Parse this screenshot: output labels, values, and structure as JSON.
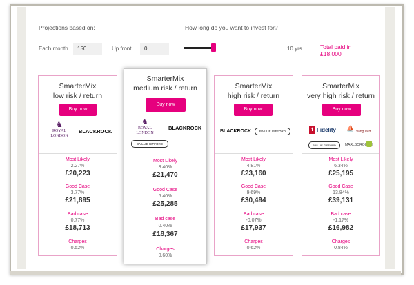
{
  "header": {
    "projections_label": "Projections based on:",
    "duration_question": "How long do you want to invest for?",
    "each_month_label": "Each month",
    "each_month_value": "150",
    "up_front_label": "Up front",
    "up_front_value": "0",
    "years_label": "10 yrs",
    "total_line1": "Total paid in",
    "total_line2": "£18,000",
    "slider_fraction": 1.0
  },
  "colors": {
    "accent": "#e6007e",
    "border": "#e9a3c8"
  },
  "cards": [
    {
      "title1": "SmarterMix",
      "title2": "low risk / return",
      "buy": "Buy now",
      "logos": [
        "ROYAL LONDON",
        "BLACKROCK"
      ],
      "most_likely_label": "Most Likely",
      "most_likely_pct": "2.27%",
      "most_likely_amt": "£20,223",
      "good_label": "Good Case",
      "good_pct": "3.77%",
      "good_amt": "£21,895",
      "bad_label": "Bad case",
      "bad_pct": "0.77%",
      "bad_amt": "£18,713",
      "charges_label": "Charges",
      "charges_pct": "0.52%"
    },
    {
      "title1": "SmarterMix",
      "title2": "medium risk / return",
      "buy": "Buy now",
      "logos": [
        "ROYAL LONDON",
        "BLACKROCK",
        "BAILLIE GIFFORD"
      ],
      "most_likely_label": "Most Likely",
      "most_likely_pct": "3.40%",
      "most_likely_amt": "£21,470",
      "good_label": "Good Case",
      "good_pct": "6.40%",
      "good_amt": "£25,285",
      "bad_label": "Bad case",
      "bad_pct": "0.40%",
      "bad_amt": "£18,367",
      "charges_label": "Charges",
      "charges_pct": "0.60%"
    },
    {
      "title1": "SmarterMix",
      "title2": "high risk / return",
      "buy": "Buy now",
      "logos": [
        "BLACKROCK",
        "BAILLIE GIFFORD"
      ],
      "most_likely_label": "Most Likely",
      "most_likely_pct": "4.81%",
      "most_likely_amt": "£23,160",
      "good_label": "Good Case",
      "good_pct": "9.69%",
      "good_amt": "£30,494",
      "bad_label": "Bad case",
      "bad_pct": "-0.07%",
      "bad_amt": "£17,937",
      "charges_label": "Charges",
      "charges_pct": "0.62%"
    },
    {
      "title1": "SmarterMix",
      "title2": "very high risk / return",
      "buy": "Buy now",
      "logos": [
        "Fidelity",
        "Vanguard",
        "BAILLIE GIFFORD",
        "MARLBOROUGH"
      ],
      "most_likely_label": "Most Likely",
      "most_likely_pct": "6.34%",
      "most_likely_amt": "£25,195",
      "good_label": "Good Case",
      "good_pct": "13.84%",
      "good_amt": "£39,131",
      "bad_label": "Bad case",
      "bad_pct": "-1.17%",
      "bad_amt": "£16,982",
      "charges_label": "Charges",
      "charges_pct": "0.84%"
    }
  ]
}
